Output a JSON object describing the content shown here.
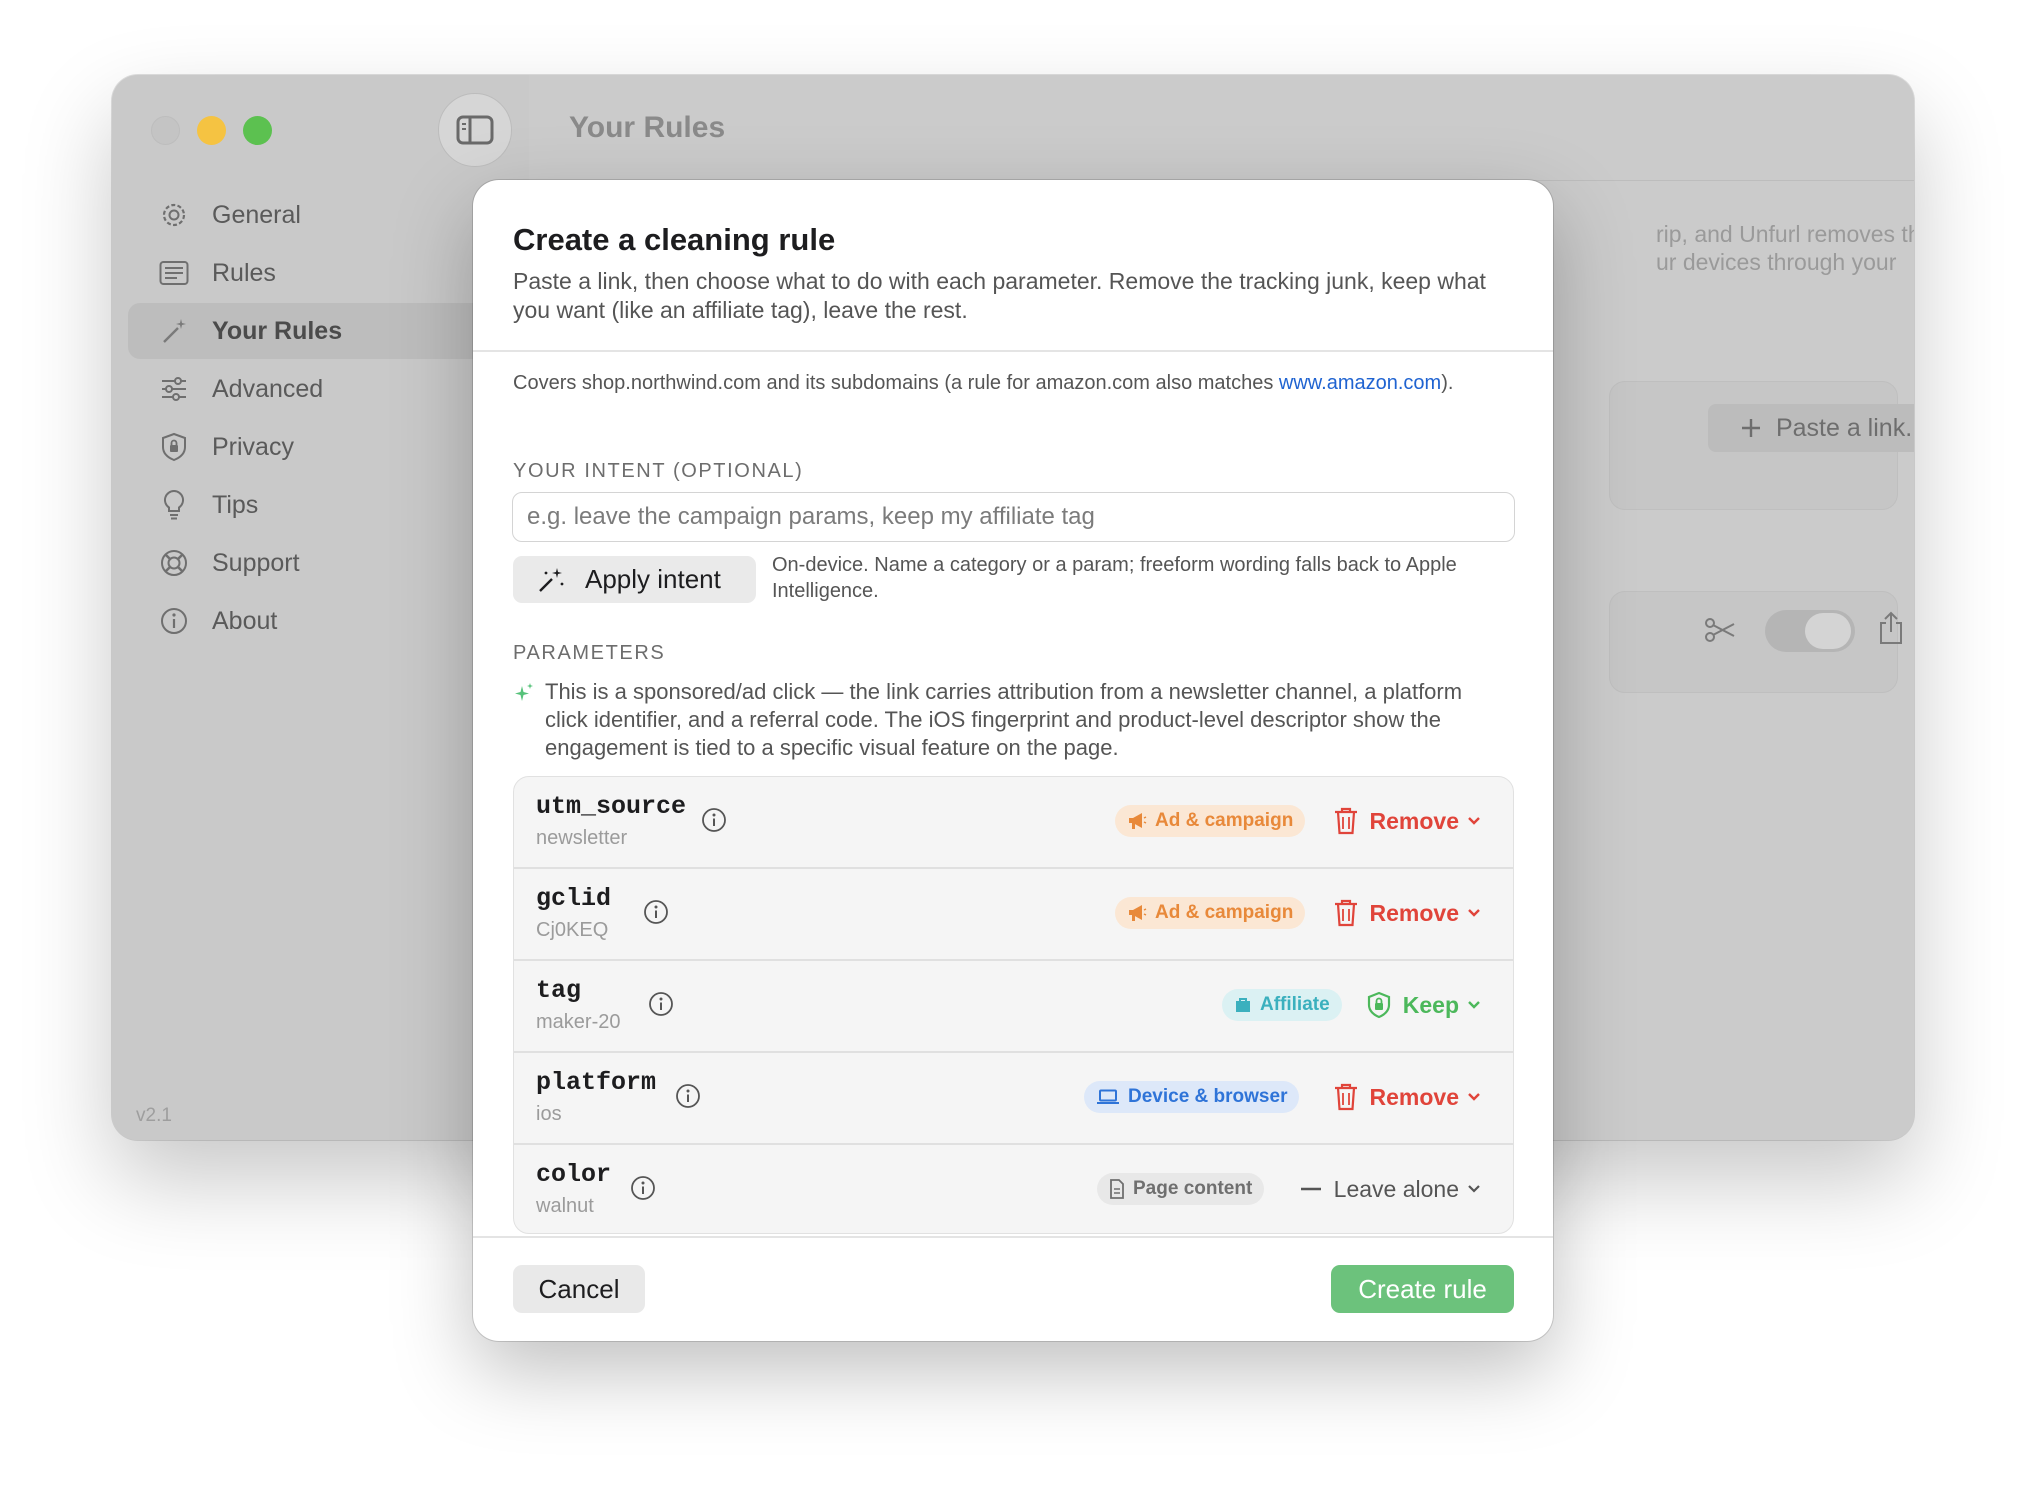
{
  "app": {
    "version": "v2.1",
    "nav": [
      {
        "label": "General",
        "icon": "gear-icon"
      },
      {
        "label": "Rules",
        "icon": "list-icon"
      },
      {
        "label": "Your Rules",
        "icon": "magic-wand-icon",
        "active": true
      },
      {
        "label": "Advanced",
        "icon": "sliders-icon"
      },
      {
        "label": "Privacy",
        "icon": "shield-icon"
      },
      {
        "label": "Tips",
        "icon": "lightbulb-icon"
      },
      {
        "label": "Support",
        "icon": "lifebuoy-icon"
      },
      {
        "label": "About",
        "icon": "info-icon"
      }
    ]
  },
  "main": {
    "title": "Your Rules",
    "desc_line1": "rip, and Unfurl removes them",
    "desc_line2": "ur devices through your",
    "paste_label": "Paste a link..."
  },
  "sheet": {
    "title": "Create a cleaning rule",
    "subtitle": "Paste a link, then choose what to do with each parameter. Remove the tracking junk, keep what you want (like an affiliate tag), leave the rest.",
    "covers_text": "Covers shop.northwind.com and its subdomains (a rule for amazon.com also matches ",
    "covers_link": "www.amazon.com",
    "covers_end": ").",
    "intent_label": "YOUR INTENT (OPTIONAL)",
    "intent_placeholder": "e.g. leave the campaign params, keep my affiliate tag",
    "apply_label": "Apply intent",
    "apply_note": "On-device. Name a category or a param; freeform wording falls back to Apple Intelligence.",
    "params_label": "PARAMETERS",
    "summary": "This is a sponsored/ad click — the link carries attribution from a newsletter channel, a platform click identifier, and a referral code. The iOS fingerprint and product-level descriptor show the engagement is tied to a specific visual feature on the page.",
    "params": [
      {
        "name": "utm_source",
        "value": "newsletter",
        "category": "Ad & campaign",
        "action": "Remove"
      },
      {
        "name": "gclid",
        "value": "Cj0KEQ",
        "category": "Ad & campaign",
        "action": "Remove"
      },
      {
        "name": "tag",
        "value": "maker-20",
        "category": "Affiliate",
        "action": "Keep"
      },
      {
        "name": "platform",
        "value": "ios",
        "category": "Device & browser",
        "action": "Remove"
      },
      {
        "name": "color",
        "value": "walnut",
        "category": "Page content",
        "action": "Leave alone"
      }
    ],
    "cancel_label": "Cancel",
    "create_label": "Create rule"
  },
  "colors": {
    "accent_green": "#6cc27c",
    "remove_red": "#e0443a",
    "keep_green": "#4cb85b",
    "ad_orange": "#e8893a",
    "affiliate_teal": "#3bb0be",
    "device_blue": "#2f74d8",
    "link_blue": "#1f63d1"
  }
}
